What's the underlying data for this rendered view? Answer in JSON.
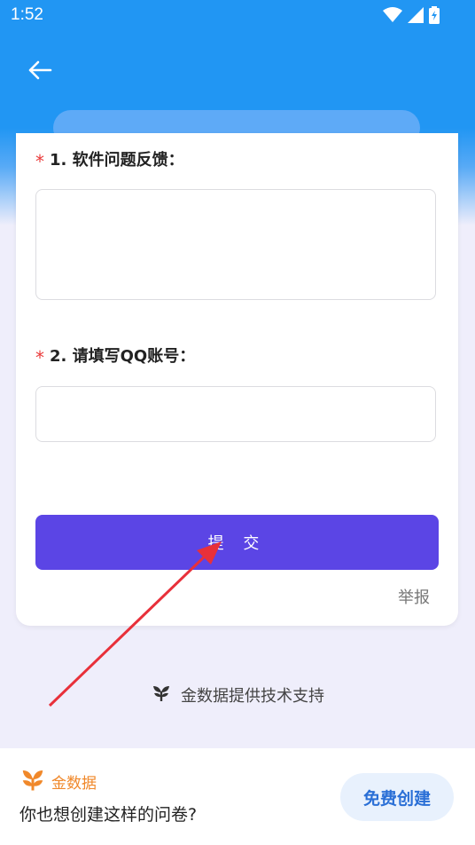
{
  "status_bar": {
    "time": "1:52"
  },
  "form": {
    "questions": [
      {
        "required_mark": "*",
        "label": "1. 软件问题反馈：",
        "value": ""
      },
      {
        "required_mark": "*",
        "label": "2. 请填写QQ账号：",
        "value": ""
      }
    ],
    "submit_label": "提 交",
    "report_label": "举报"
  },
  "support": {
    "text": "金数据提供技术支持",
    "icon": "jinshuju-logo-icon"
  },
  "banner": {
    "brand_name": "金数据",
    "promo_text": "你也想创建这样的问卷?",
    "create_label": "免费创建"
  },
  "colors": {
    "primary_blue": "#2196f3",
    "submit_purple": "#5b45e5",
    "required_red": "#ea3b3b",
    "brand_orange": "#f0882a",
    "annotation_arrow": "#e8303a"
  }
}
